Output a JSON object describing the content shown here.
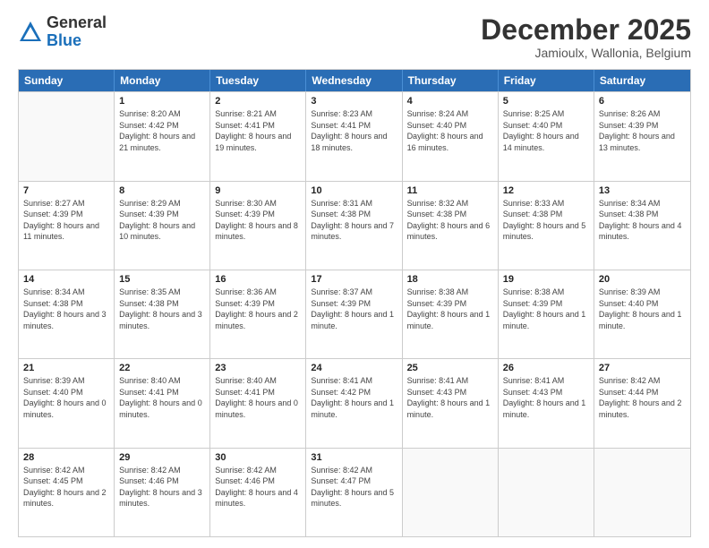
{
  "header": {
    "logo": {
      "general": "General",
      "blue": "Blue"
    },
    "month": "December 2025",
    "location": "Jamioulx, Wallonia, Belgium"
  },
  "days_of_week": [
    "Sunday",
    "Monday",
    "Tuesday",
    "Wednesday",
    "Thursday",
    "Friday",
    "Saturday"
  ],
  "weeks": [
    [
      {
        "day": "",
        "empty": true
      },
      {
        "day": "1",
        "sunrise": "8:20 AM",
        "sunset": "4:42 PM",
        "daylight": "8 hours and 21 minutes."
      },
      {
        "day": "2",
        "sunrise": "8:21 AM",
        "sunset": "4:41 PM",
        "daylight": "8 hours and 19 minutes."
      },
      {
        "day": "3",
        "sunrise": "8:23 AM",
        "sunset": "4:41 PM",
        "daylight": "8 hours and 18 minutes."
      },
      {
        "day": "4",
        "sunrise": "8:24 AM",
        "sunset": "4:40 PM",
        "daylight": "8 hours and 16 minutes."
      },
      {
        "day": "5",
        "sunrise": "8:25 AM",
        "sunset": "4:40 PM",
        "daylight": "8 hours and 14 minutes."
      },
      {
        "day": "6",
        "sunrise": "8:26 AM",
        "sunset": "4:39 PM",
        "daylight": "8 hours and 13 minutes."
      }
    ],
    [
      {
        "day": "7",
        "sunrise": "8:27 AM",
        "sunset": "4:39 PM",
        "daylight": "8 hours and 11 minutes."
      },
      {
        "day": "8",
        "sunrise": "8:29 AM",
        "sunset": "4:39 PM",
        "daylight": "8 hours and 10 minutes."
      },
      {
        "day": "9",
        "sunrise": "8:30 AM",
        "sunset": "4:39 PM",
        "daylight": "8 hours and 8 minutes."
      },
      {
        "day": "10",
        "sunrise": "8:31 AM",
        "sunset": "4:38 PM",
        "daylight": "8 hours and 7 minutes."
      },
      {
        "day": "11",
        "sunrise": "8:32 AM",
        "sunset": "4:38 PM",
        "daylight": "8 hours and 6 minutes."
      },
      {
        "day": "12",
        "sunrise": "8:33 AM",
        "sunset": "4:38 PM",
        "daylight": "8 hours and 5 minutes."
      },
      {
        "day": "13",
        "sunrise": "8:34 AM",
        "sunset": "4:38 PM",
        "daylight": "8 hours and 4 minutes."
      }
    ],
    [
      {
        "day": "14",
        "sunrise": "8:34 AM",
        "sunset": "4:38 PM",
        "daylight": "8 hours and 3 minutes."
      },
      {
        "day": "15",
        "sunrise": "8:35 AM",
        "sunset": "4:38 PM",
        "daylight": "8 hours and 3 minutes."
      },
      {
        "day": "16",
        "sunrise": "8:36 AM",
        "sunset": "4:39 PM",
        "daylight": "8 hours and 2 minutes."
      },
      {
        "day": "17",
        "sunrise": "8:37 AM",
        "sunset": "4:39 PM",
        "daylight": "8 hours and 1 minute."
      },
      {
        "day": "18",
        "sunrise": "8:38 AM",
        "sunset": "4:39 PM",
        "daylight": "8 hours and 1 minute."
      },
      {
        "day": "19",
        "sunrise": "8:38 AM",
        "sunset": "4:39 PM",
        "daylight": "8 hours and 1 minute."
      },
      {
        "day": "20",
        "sunrise": "8:39 AM",
        "sunset": "4:40 PM",
        "daylight": "8 hours and 1 minute."
      }
    ],
    [
      {
        "day": "21",
        "sunrise": "8:39 AM",
        "sunset": "4:40 PM",
        "daylight": "8 hours and 0 minutes."
      },
      {
        "day": "22",
        "sunrise": "8:40 AM",
        "sunset": "4:41 PM",
        "daylight": "8 hours and 0 minutes."
      },
      {
        "day": "23",
        "sunrise": "8:40 AM",
        "sunset": "4:41 PM",
        "daylight": "8 hours and 0 minutes."
      },
      {
        "day": "24",
        "sunrise": "8:41 AM",
        "sunset": "4:42 PM",
        "daylight": "8 hours and 1 minute."
      },
      {
        "day": "25",
        "sunrise": "8:41 AM",
        "sunset": "4:43 PM",
        "daylight": "8 hours and 1 minute."
      },
      {
        "day": "26",
        "sunrise": "8:41 AM",
        "sunset": "4:43 PM",
        "daylight": "8 hours and 1 minute."
      },
      {
        "day": "27",
        "sunrise": "8:42 AM",
        "sunset": "4:44 PM",
        "daylight": "8 hours and 2 minutes."
      }
    ],
    [
      {
        "day": "28",
        "sunrise": "8:42 AM",
        "sunset": "4:45 PM",
        "daylight": "8 hours and 2 minutes."
      },
      {
        "day": "29",
        "sunrise": "8:42 AM",
        "sunset": "4:46 PM",
        "daylight": "8 hours and 3 minutes."
      },
      {
        "day": "30",
        "sunrise": "8:42 AM",
        "sunset": "4:46 PM",
        "daylight": "8 hours and 4 minutes."
      },
      {
        "day": "31",
        "sunrise": "8:42 AM",
        "sunset": "4:47 PM",
        "daylight": "8 hours and 5 minutes."
      },
      {
        "day": "",
        "empty": true
      },
      {
        "day": "",
        "empty": true
      },
      {
        "day": "",
        "empty": true
      }
    ]
  ]
}
